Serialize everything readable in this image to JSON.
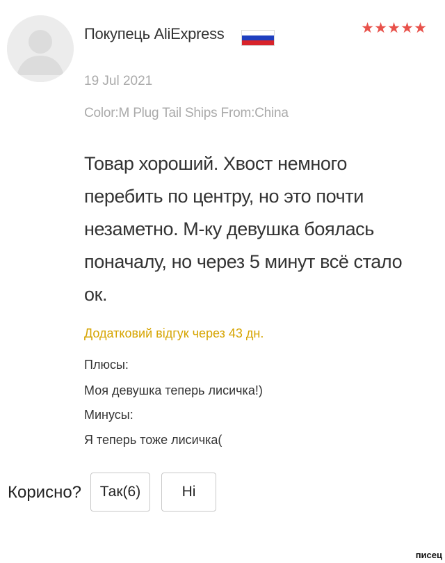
{
  "review": {
    "avatar": {
      "icon": "user-silhouette-icon"
    },
    "user_name": "Покупець AliExpress",
    "flag": {
      "icon": "russia-flag-icon",
      "colors": [
        "#ffffff",
        "#1f3fbf",
        "#d8232a"
      ]
    },
    "rating": {
      "value": 5,
      "max": 5,
      "icon": "star-icon",
      "color": "#e8514a",
      "glyphs": [
        "★",
        "★",
        "★",
        "★",
        "★"
      ]
    },
    "date": "19 Jul 2021",
    "sku": "Color:M Plug Tail Ships From:China",
    "text": "Товар хороший. Хвост немного перебить по центру, но это почти незаметно. М-ку девушка боялась поначалу, но через 5 минут всё стало ок.",
    "additional_feedback_title": "Додатковий відгук через 43 дн.",
    "additional_feedback_color": "#d6a400",
    "pros_label": "Плюсы:",
    "pros_text": "Моя девушка теперь лисичка!)",
    "cons_label": "Минусы:",
    "cons_text": "Я теперь тоже лисичка("
  },
  "helpful": {
    "label": "Корисно?",
    "yes_label": "Так(6)",
    "no_label": "Ні"
  },
  "watermark": "писец"
}
